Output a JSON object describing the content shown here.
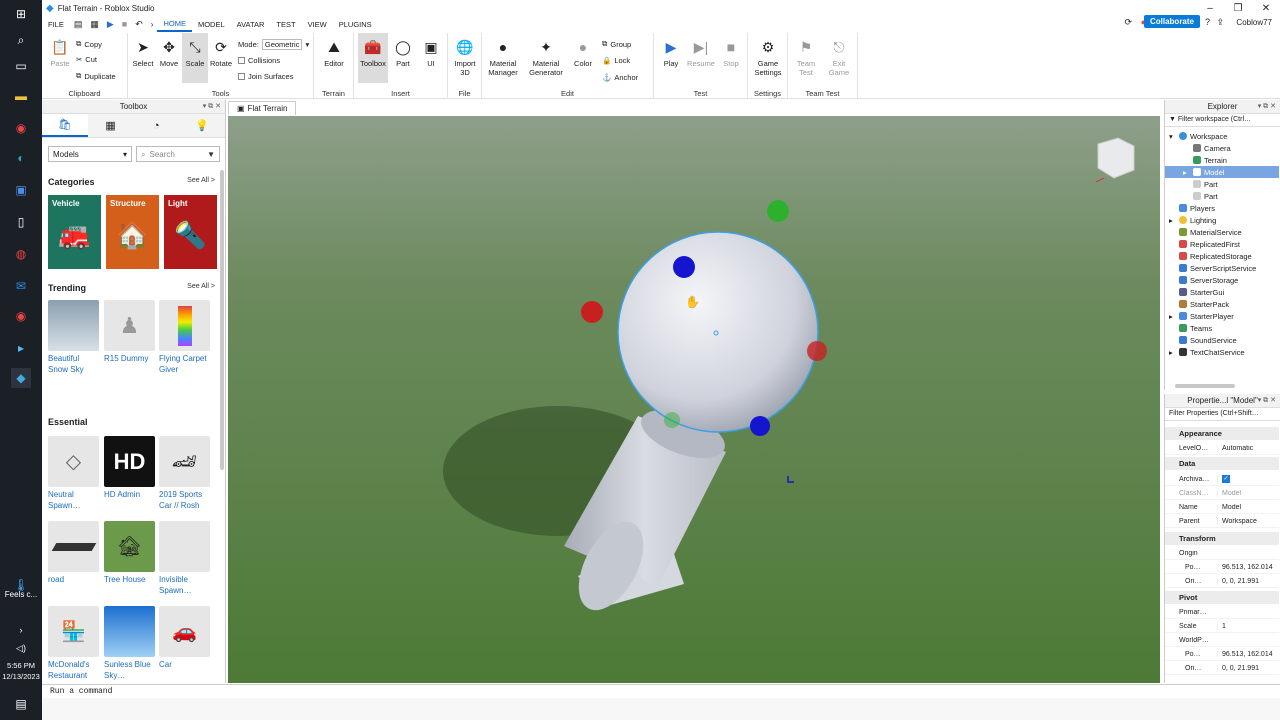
{
  "window": {
    "title": "Flat Terrain - Roblox Studio",
    "user": "Coblow77",
    "collaborate": "Collaborate"
  },
  "taskbar": {
    "time": "5:56 PM",
    "date": "12/13/2023",
    "weather": "Feels c..."
  },
  "menu": [
    "FILE",
    "HOME",
    "MODEL",
    "AVATAR",
    "TEST",
    "VIEW",
    "PLUGINS"
  ],
  "ribbon": {
    "clipboard": {
      "paste": "Paste",
      "copy": "Copy",
      "cut": "Cut",
      "duplicate": "Duplicate",
      "label": "Clipboard"
    },
    "tools": {
      "select": "Select",
      "move": "Move",
      "scale": "Scale",
      "rotate": "Rotate",
      "mode_label": "Mode:",
      "mode_value": "Geometric",
      "collisions": "Collisions",
      "join": "Join Surfaces",
      "label": "Tools"
    },
    "terrain": {
      "editor": "Editor",
      "label": "Terrain"
    },
    "insert": {
      "toolbox": "Toolbox",
      "part": "Part",
      "ui": "UI",
      "label": "Insert"
    },
    "file": {
      "import": "Import 3D",
      "label": "File"
    },
    "edit": {
      "material_manager": "Material Manager",
      "material_generator": "Material Generator",
      "color": "Color",
      "group": "Group",
      "lock": "Lock",
      "anchor": "Anchor",
      "label": "Edit"
    },
    "test": {
      "play": "Play",
      "resume": "Resume",
      "stop": "Stop",
      "label": "Test"
    },
    "settings": {
      "game": "Game Settings",
      "label": "Settings"
    },
    "team_test": {
      "team": "Team Test",
      "exit": "Exit Game",
      "label": "Team Test"
    }
  },
  "toolbox": {
    "title": "Toolbox",
    "filter": "Models",
    "search_placeholder": "Search",
    "categories_label": "Categories",
    "see_all": "See All >",
    "categories": [
      "Vehicle",
      "Structure",
      "Light"
    ],
    "trending_label": "Trending",
    "trending": [
      "Beautiful Snow Sky",
      "R15 Dummy",
      "Flying Carpet Giver"
    ],
    "essential_label": "Essential",
    "essential": [
      "Neutral Spawn…",
      "HD Admin",
      "2019 Sports Car // Rosh",
      "road",
      "Tree House",
      "Invisible Spawn…",
      "McDonald's Restaurant",
      "Sunless Blue Sky…",
      "Car"
    ]
  },
  "viewport": {
    "tab": "Flat Terrain"
  },
  "explorer": {
    "title": "Explorer",
    "filter": "Filter workspace (Ctrl…",
    "items": [
      "Workspace",
      "Camera",
      "Terrain",
      "Model",
      "Part",
      "Part",
      "Players",
      "Lighting",
      "MaterialService",
      "ReplicatedFirst",
      "ReplicatedStorage",
      "ServerScriptService",
      "ServerStorage",
      "StarterGui",
      "StarterPack",
      "StarterPlayer",
      "Teams",
      "SoundService",
      "TextChatService"
    ]
  },
  "properties": {
    "title": "Propertie...l \"Model\"",
    "filter": "Filter Properties (Ctrl+Shift…",
    "appearance": "Appearance",
    "level_k": "LevelO…",
    "level_v": "Automatic",
    "data": "Data",
    "arch_k": "Archiva…",
    "class_k": "ClassN…",
    "class_v": "Model",
    "name_k": "Name",
    "name_v": "Model",
    "parent_k": "Parent",
    "parent_v": "Workspace",
    "transform": "Transform",
    "origin_k": "Origin",
    "pos_k": "Po…",
    "pos_v": "96.513, 162.014",
    "ori_k": "Ori…",
    "ori_v": "0, 0, 21.991",
    "pivot": "Pivot",
    "prim_k": "Primar…",
    "scale_k": "Scale",
    "scale_v": "1",
    "world_k": "WorldP…",
    "wpos_k": "Po…",
    "wpos_v": "96.513, 162.014",
    "wori_k": "Ori…",
    "wori_v": "0, 0, 21.991"
  },
  "command": {
    "placeholder": "Run a command"
  }
}
